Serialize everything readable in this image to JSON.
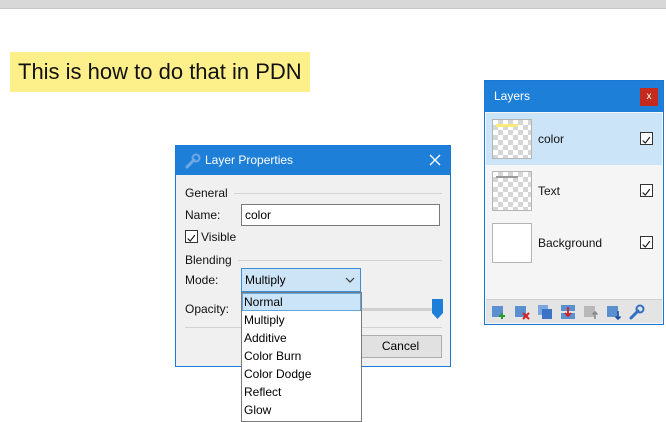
{
  "caption": "This is how to do that in PDN",
  "dialog": {
    "title": "Layer Properties",
    "general_label": "General",
    "name_label": "Name:",
    "name_value": "color",
    "visible_label": "Visible",
    "blending_label": "Blending",
    "mode_label": "Mode:",
    "mode_value": "Multiply",
    "opacity_label": "Opacity:",
    "opacity_level": 1.0,
    "cancel_label": "Cancel"
  },
  "mode_options": [
    "Normal",
    "Multiply",
    "Additive",
    "Color Burn",
    "Color Dodge",
    "Reflect",
    "Glow"
  ],
  "mode_highlighted": "Normal",
  "layers_panel": {
    "title": "Layers",
    "close_label": "x",
    "layers": [
      {
        "name": "color",
        "visible": true,
        "selected": true
      },
      {
        "name": "Text",
        "visible": true,
        "selected": false
      },
      {
        "name": "Background",
        "visible": true,
        "selected": false
      }
    ],
    "toolbar_icons": [
      "add-layer-icon",
      "delete-layer-icon",
      "duplicate-layer-icon",
      "merge-layer-down-icon",
      "move-layer-up-icon",
      "move-layer-down-icon",
      "layer-properties-icon"
    ]
  },
  "colors": {
    "titlebar": "#1e7fd8",
    "selection": "#cce4f7",
    "caption_bg": "#fdf08a",
    "close_red": "#c42b1c"
  }
}
